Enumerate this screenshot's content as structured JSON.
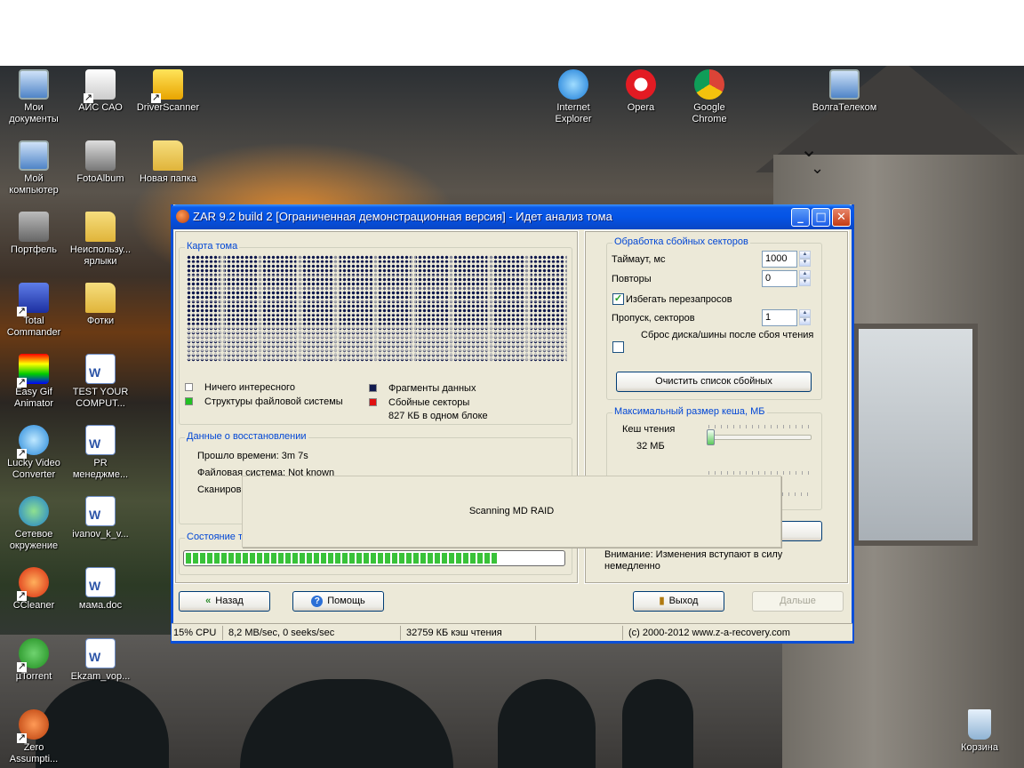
{
  "desktop": {
    "icons": [
      {
        "label": "Мои\nдокументы",
        "icon": "my-documents-icon"
      },
      {
        "label": "АИС САО",
        "icon": "ais-sao-icon"
      },
      {
        "label": "DriverScanner",
        "icon": "driver-scanner-icon"
      },
      {
        "label": "Internet\nExplorer",
        "icon": "internet-explorer-icon"
      },
      {
        "label": "Opera",
        "icon": "opera-icon"
      },
      {
        "label": "Google\nChrome",
        "icon": "google-chrome-icon"
      },
      {
        "label": "ВолгаТелеком",
        "icon": "network-computer-icon"
      },
      {
        "label": "Мой\nкомпьютер",
        "icon": "my-computer-icon"
      },
      {
        "label": "FotoAlbum",
        "icon": "camera-icon"
      },
      {
        "label": "Новая папка",
        "icon": "folder-icon"
      },
      {
        "label": "Портфель",
        "icon": "briefcase-icon"
      },
      {
        "label": "Неиспользу...\nярлыки",
        "icon": "folder-icon"
      },
      {
        "label": "Total\nCommander",
        "icon": "floppy-icon"
      },
      {
        "label": "Фотки",
        "icon": "folder-icon"
      },
      {
        "label": "Easy Gif\nAnimator",
        "icon": "gif-animator-icon"
      },
      {
        "label": "TEST YOUR\nCOMPUT...",
        "icon": "word-document-icon"
      },
      {
        "label": "Lucky Video\nConverter",
        "icon": "video-converter-icon"
      },
      {
        "label": "PR\nменеджме...",
        "icon": "word-document-icon"
      },
      {
        "label": "Сетевое\nокружение",
        "icon": "network-places-icon"
      },
      {
        "label": "ivanov_k_v...",
        "icon": "word-document-icon"
      },
      {
        "label": "CCleaner",
        "icon": "ccleaner-icon"
      },
      {
        "label": "мама.doc",
        "icon": "word-document-icon"
      },
      {
        "label": "µTorrent",
        "icon": "utorrent-icon"
      },
      {
        "label": "Ekzam_vop...",
        "icon": "word-document-icon"
      },
      {
        "label": "Zero\nAssumpti...",
        "icon": "zero-assumption-icon"
      },
      {
        "label": "Корзина",
        "icon": "recycle-bin-icon"
      }
    ]
  },
  "window": {
    "title": "ZAR 9.2 build 2 [Ограниченная демонстрационная версия] - Идет анализ тома",
    "left": {
      "map_group": "Карта тома",
      "legend": {
        "nothing": "Ничего интересного",
        "fs_structures": "Структуры файловой системы",
        "data_fragments": "Фрагменты данных",
        "bad_sectors": "Сбойные секторы",
        "block_size": "827 КБ в одном блоке"
      },
      "recovery_group": "Данные о восстановлении",
      "elapsed": "Прошло времени: 3m 7s",
      "filesystem": "Файловая система: Not known",
      "scanning": "Сканиров",
      "status_group": "Состояние те",
      "progress": 0.83
    },
    "right": {
      "bad_group": "Обработка сбойных секторов",
      "timeout_label": "Таймаут, мс",
      "timeout_value": "1000",
      "retries_label": "Повторы",
      "retries_value": "0",
      "avoid_label": "Избегать перезапросов",
      "avoid_checked": true,
      "skip_label": "Пропуск, секторов",
      "skip_value": "1",
      "reset_label": "Сброс диска/шины после сбоя чтения",
      "reset_checked": false,
      "clear_button": "Очистить список сбойных",
      "cache_group": "Максимальный размер кеша, МБ",
      "read_cache_label": "Кеш чтения",
      "read_cache_value": "32 МБ",
      "note": "Внимание: Изменения вступают в силу немедленно"
    },
    "buttons": {
      "back": "Назад",
      "help": "Помощь",
      "exit": "Выход",
      "next": "Дальше"
    },
    "popup": "Scanning MD RAID",
    "statusbar": {
      "cpu": "15% CPU",
      "speed": "8,2 MB/sec, 0 seeks/sec",
      "cache": "32759 КБ кэш чтения",
      "copyright": "(c) 2000-2012 www.z-a-recovery.com"
    }
  }
}
